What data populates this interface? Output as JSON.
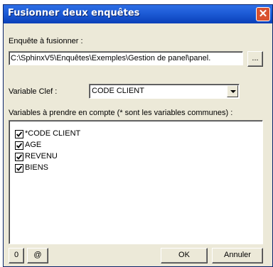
{
  "dialog": {
    "title": "Fusionner deux enquêtes",
    "close_glyph": "✕"
  },
  "survey": {
    "label": "Enquête à fusionner :",
    "path": "C:\\SphinxV5\\Enquêtes\\Exemples\\Gestion de panel\\panel.",
    "browse_label": "..."
  },
  "key_variable": {
    "label": "Variable Clef :",
    "selected": "CODE CLIENT"
  },
  "variables": {
    "label": "Variables à prendre en compte (* sont les variables communes) :",
    "items": [
      {
        "label": "*CODE CLIENT",
        "checked": true
      },
      {
        "label": "AGE",
        "checked": true
      },
      {
        "label": "REVENU",
        "checked": true
      },
      {
        "label": "BIENS",
        "checked": true
      }
    ]
  },
  "buttons": {
    "zero_label": "0",
    "at_label": "@",
    "ok_label": "OK",
    "cancel_label": "Annuler"
  },
  "colors": {
    "titlebar": "#1d5bd6",
    "dialog_bg": "#ece9d8",
    "close_button": "#d9512f"
  }
}
